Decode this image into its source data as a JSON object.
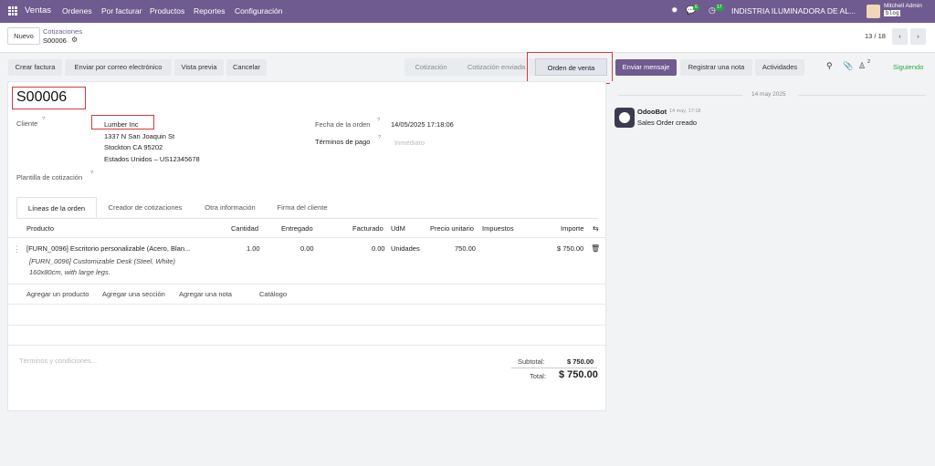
{
  "nav": {
    "app": "Ventas",
    "menu": [
      "Ordenes",
      "Por facturar",
      "Productos",
      "Reportes",
      "Configuración"
    ],
    "chat_count": "6",
    "activity_count": "17",
    "company": "INDISTRIA ILUMINADORA DE AL...",
    "user_name": "Mitchell Admin",
    "db_name": "blog"
  },
  "control": {
    "new_label": "Nuevo",
    "breadcrumb_parent": "Cotizaciones",
    "breadcrumb_current": "S00006",
    "pager": "13 / 18",
    "following": "Siguiendo",
    "followers_count": "2"
  },
  "actions": {
    "invoice": "Crear factura",
    "email": "Enviar por correo electrónico",
    "preview": "Vista previa",
    "cancel": "Cancelar"
  },
  "status": {
    "stage1": "Cotización",
    "stage2": "Cotización enviada",
    "stage3": "Orden de venta"
  },
  "chatter_buttons": {
    "send": "Enviar mensaje",
    "note": "Registrar una nota",
    "activities": "Actividades"
  },
  "order": {
    "name": "S00006",
    "customer_label": "Cliente",
    "customer": "Lumber Inc",
    "address1": "1337 N San Joaquin St",
    "address2": "Stockton CA 95202",
    "address3": "Estados Unidos – US12345678",
    "template_label": "Plantilla de cotización",
    "date_label": "Fecha de la orden",
    "date_value": "14/05/2025 17:18:06",
    "terms_label": "Términos de pago",
    "terms_placeholder": "Inmediato"
  },
  "tabs": [
    "Líneas de la orden",
    "Creador de cotizaciones",
    "Otra información",
    "Firma del cliente"
  ],
  "lines": {
    "headers": {
      "product": "Producto",
      "qty": "Cantidad",
      "delivered": "Entregado",
      "invoiced": "Facturado",
      "uom": "UdM",
      "price": "Precio unitario",
      "taxes": "Impuestos",
      "subtotal": "Importe"
    },
    "row": {
      "product": "[FURN_0096] Escritorio personalizable (Acero, Blan...",
      "desc1": "[FURN_0096] Customizable Desk (Steel, White)",
      "desc2": "160x80cm, with large legs.",
      "qty": "1.00",
      "delivered": "0.00",
      "invoiced": "0.00",
      "uom": "Unidades",
      "price": "750.00",
      "subtotal": "$ 750.00"
    },
    "add_product": "Agregar un producto",
    "add_section": "Agregar una sección",
    "add_note": "Agregar una nota",
    "catalog": "Catálogo"
  },
  "totals": {
    "terms_placeholder": "Términos y condiciones...",
    "subtotal_label": "Subtotal:",
    "subtotal_value": "$ 750.00",
    "total_label": "Total:",
    "total_value": "$ 750.00"
  },
  "chatter": {
    "date": "14 may 2025",
    "author": "OdooBot",
    "time": "14 may, 17:18",
    "message": "Sales Order creado"
  },
  "colors": {
    "brand": "#6f5b8f",
    "highlight": "#d43b3b",
    "following": "#28a745"
  }
}
